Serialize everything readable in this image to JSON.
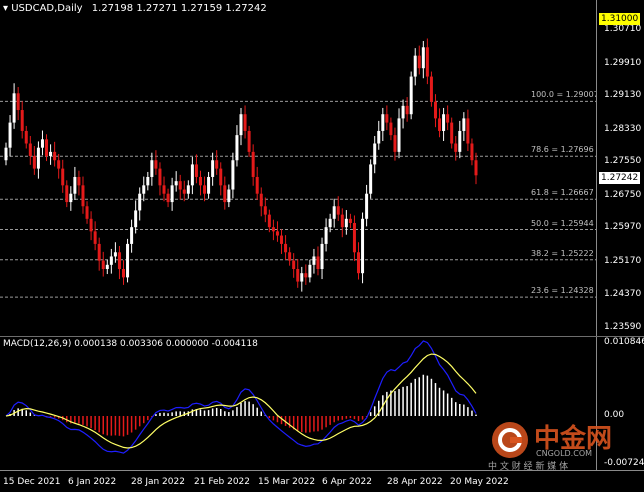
{
  "header": {
    "symbol": "USDCAD,Daily",
    "ohlc": "1.27198 1.27271 1.27159 1.27242"
  },
  "price_axis": {
    "labels": [
      "1.30710",
      "1.29910",
      "1.29130",
      "1.28330",
      "1.27550",
      "1.26750",
      "1.25970",
      "1.25170",
      "1.24370",
      "1.23590"
    ],
    "top_box": "1.31000",
    "current_box": "1.27242"
  },
  "fib_levels": [
    {
      "label": "100.0 = 1.29007",
      "value": 1.29007
    },
    {
      "label": "78.6 = 1.27696",
      "value": 1.27696
    },
    {
      "label": "61.8 = 1.26667",
      "value": 1.26667
    },
    {
      "label": "50.0 = 1.25944",
      "value": 1.25944
    },
    {
      "label": "38.2 = 1.25222",
      "value": 1.25222
    },
    {
      "label": "23.6 = 1.24328",
      "value": 1.24328
    }
  ],
  "macd": {
    "header": "MACD(12,26,9) 0.000138 0.003306 0.000000 -0.004118",
    "axis_labels": [
      "0.010846",
      "0.00",
      "-0.00724"
    ]
  },
  "x_labels": [
    "15 Dec 2021",
    "6 Jan 2022",
    "28 Jan 2022",
    "21 Feb 2022",
    "15 Mar 2022",
    "6 Apr 2022",
    "28 Apr 2022",
    "20 May 2022"
  ],
  "watermark": {
    "name": "中金网",
    "domain": "CNGOLD.COM",
    "tagline": "中 文 财 经 新 媒 体"
  },
  "colors": {
    "bull": "#ffffff",
    "bear": "#e41a1a",
    "fib": "#9a9a9a",
    "signal": "#ffff66",
    "main_line": "#1e1eff",
    "hist_pos": "#ffffff",
    "hist_neg": "#e41a1a"
  },
  "chart_data": {
    "type": "candlestick",
    "symbol": "USDCAD",
    "timeframe": "Daily",
    "y_range": [
      1.2359,
      1.31
    ],
    "series_close": [
      1.279,
      1.285,
      1.292,
      1.288,
      1.283,
      1.28,
      1.277,
      1.274,
      1.279,
      1.281,
      1.277,
      1.278,
      1.276,
      1.274,
      1.27,
      1.266,
      1.268,
      1.272,
      1.27,
      1.265,
      1.262,
      1.259,
      1.256,
      1.252,
      1.25,
      1.251,
      1.253,
      1.254,
      1.25,
      1.248,
      1.256,
      1.26,
      1.264,
      1.268,
      1.27,
      1.272,
      1.276,
      1.274,
      1.27,
      1.268,
      1.266,
      1.27,
      1.271,
      1.269,
      1.268,
      1.27,
      1.275,
      1.272,
      1.27,
      1.268,
      1.272,
      1.276,
      1.274,
      1.27,
      1.266,
      1.269,
      1.276,
      1.282,
      1.287,
      1.283,
      1.278,
      1.272,
      1.268,
      1.265,
      1.263,
      1.26,
      1.259,
      1.258,
      1.256,
      1.254,
      1.252,
      1.25,
      1.247,
      1.249,
      1.248,
      1.251,
      1.253,
      1.25,
      1.256,
      1.26,
      1.262,
      1.265,
      1.263,
      1.26,
      1.262,
      1.261,
      1.254,
      1.249,
      1.262,
      1.268,
      1.275,
      1.28,
      1.283,
      1.287,
      1.285,
      1.282,
      1.278,
      1.286,
      1.289,
      1.287,
      1.296,
      1.301,
      1.298,
      1.303,
      1.296,
      1.29,
      1.286,
      1.283,
      1.287,
      1.285,
      1.28,
      1.278,
      1.283,
      1.286,
      1.28,
      1.276,
      1.2724
    ]
  }
}
